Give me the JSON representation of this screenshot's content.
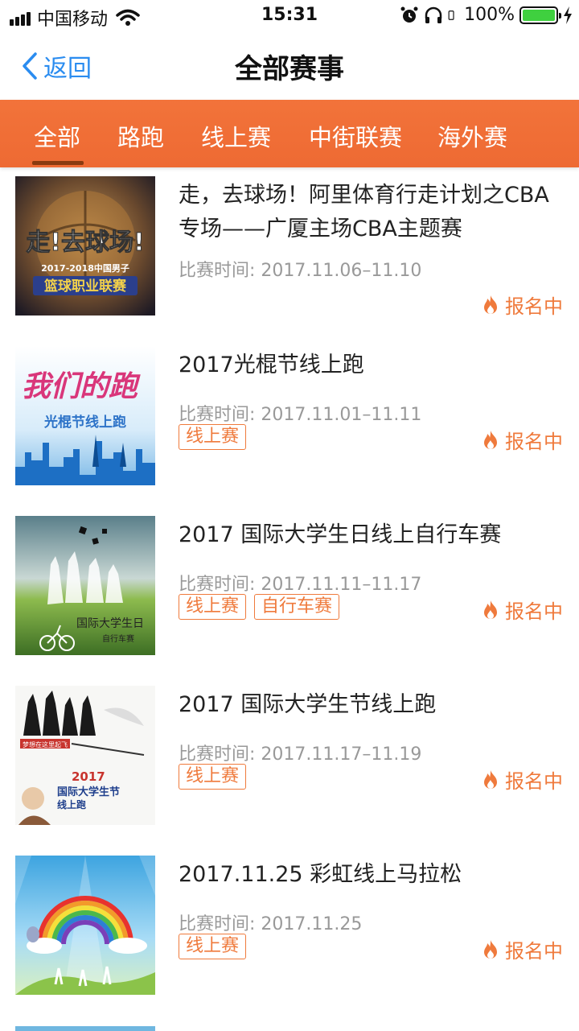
{
  "status_bar": {
    "carrier": "中国移动",
    "time": "15:31",
    "battery_percent": "100%",
    "battery_level": 1.0,
    "battery_color": "#3fd03f"
  },
  "nav": {
    "back_label": "返回",
    "title": "全部赛事"
  },
  "tabs": [
    {
      "label": "全部",
      "active": true
    },
    {
      "label": "路跑"
    },
    {
      "label": "线上赛"
    },
    {
      "label": "中街联赛"
    },
    {
      "label": "海外赛"
    }
  ],
  "events": [
    {
      "title": "走，去球场！阿里体育行走计划之CBA专场——广厦主场CBA主题赛",
      "date": "比赛时间: 2017.11.06–11.10",
      "tags": [],
      "status": "报名中",
      "thumb_text": [
        "走!去球场!",
        "2017-2018中国男子",
        "篮球职业联赛"
      ]
    },
    {
      "title": "2017光棍节线上跑",
      "date": "比赛时间: 2017.11.01–11.11",
      "tags": [
        "线上赛"
      ],
      "status": "报名中",
      "thumb_text": [
        "我们的跑",
        "光棍节线上跑"
      ]
    },
    {
      "title": "2017 国际大学生日线上自行车赛",
      "date": "比赛时间: 2017.11.11–11.17",
      "tags": [
        "线上赛",
        "自行车赛"
      ],
      "status": "报名中",
      "thumb_text": [
        "国际大学生日",
        "自行车赛"
      ]
    },
    {
      "title": "2017 国际大学生节线上跑",
      "date": "比赛时间: 2017.11.17–11.19",
      "tags": [
        "线上赛"
      ],
      "status": "报名中",
      "thumb_text": [
        "梦想在这里起飞",
        "2017",
        "国际大学生节",
        "线上跑"
      ]
    },
    {
      "title": "2017.11.25 彩虹线上马拉松",
      "date": "比赛时间: 2017.11.25",
      "tags": [
        "线上赛"
      ],
      "status": "报名中",
      "thumb_text": []
    }
  ],
  "colors": {
    "accent": "#ef7a3c",
    "tab_bar": "#f0703a",
    "link": "#2a8cf0"
  }
}
